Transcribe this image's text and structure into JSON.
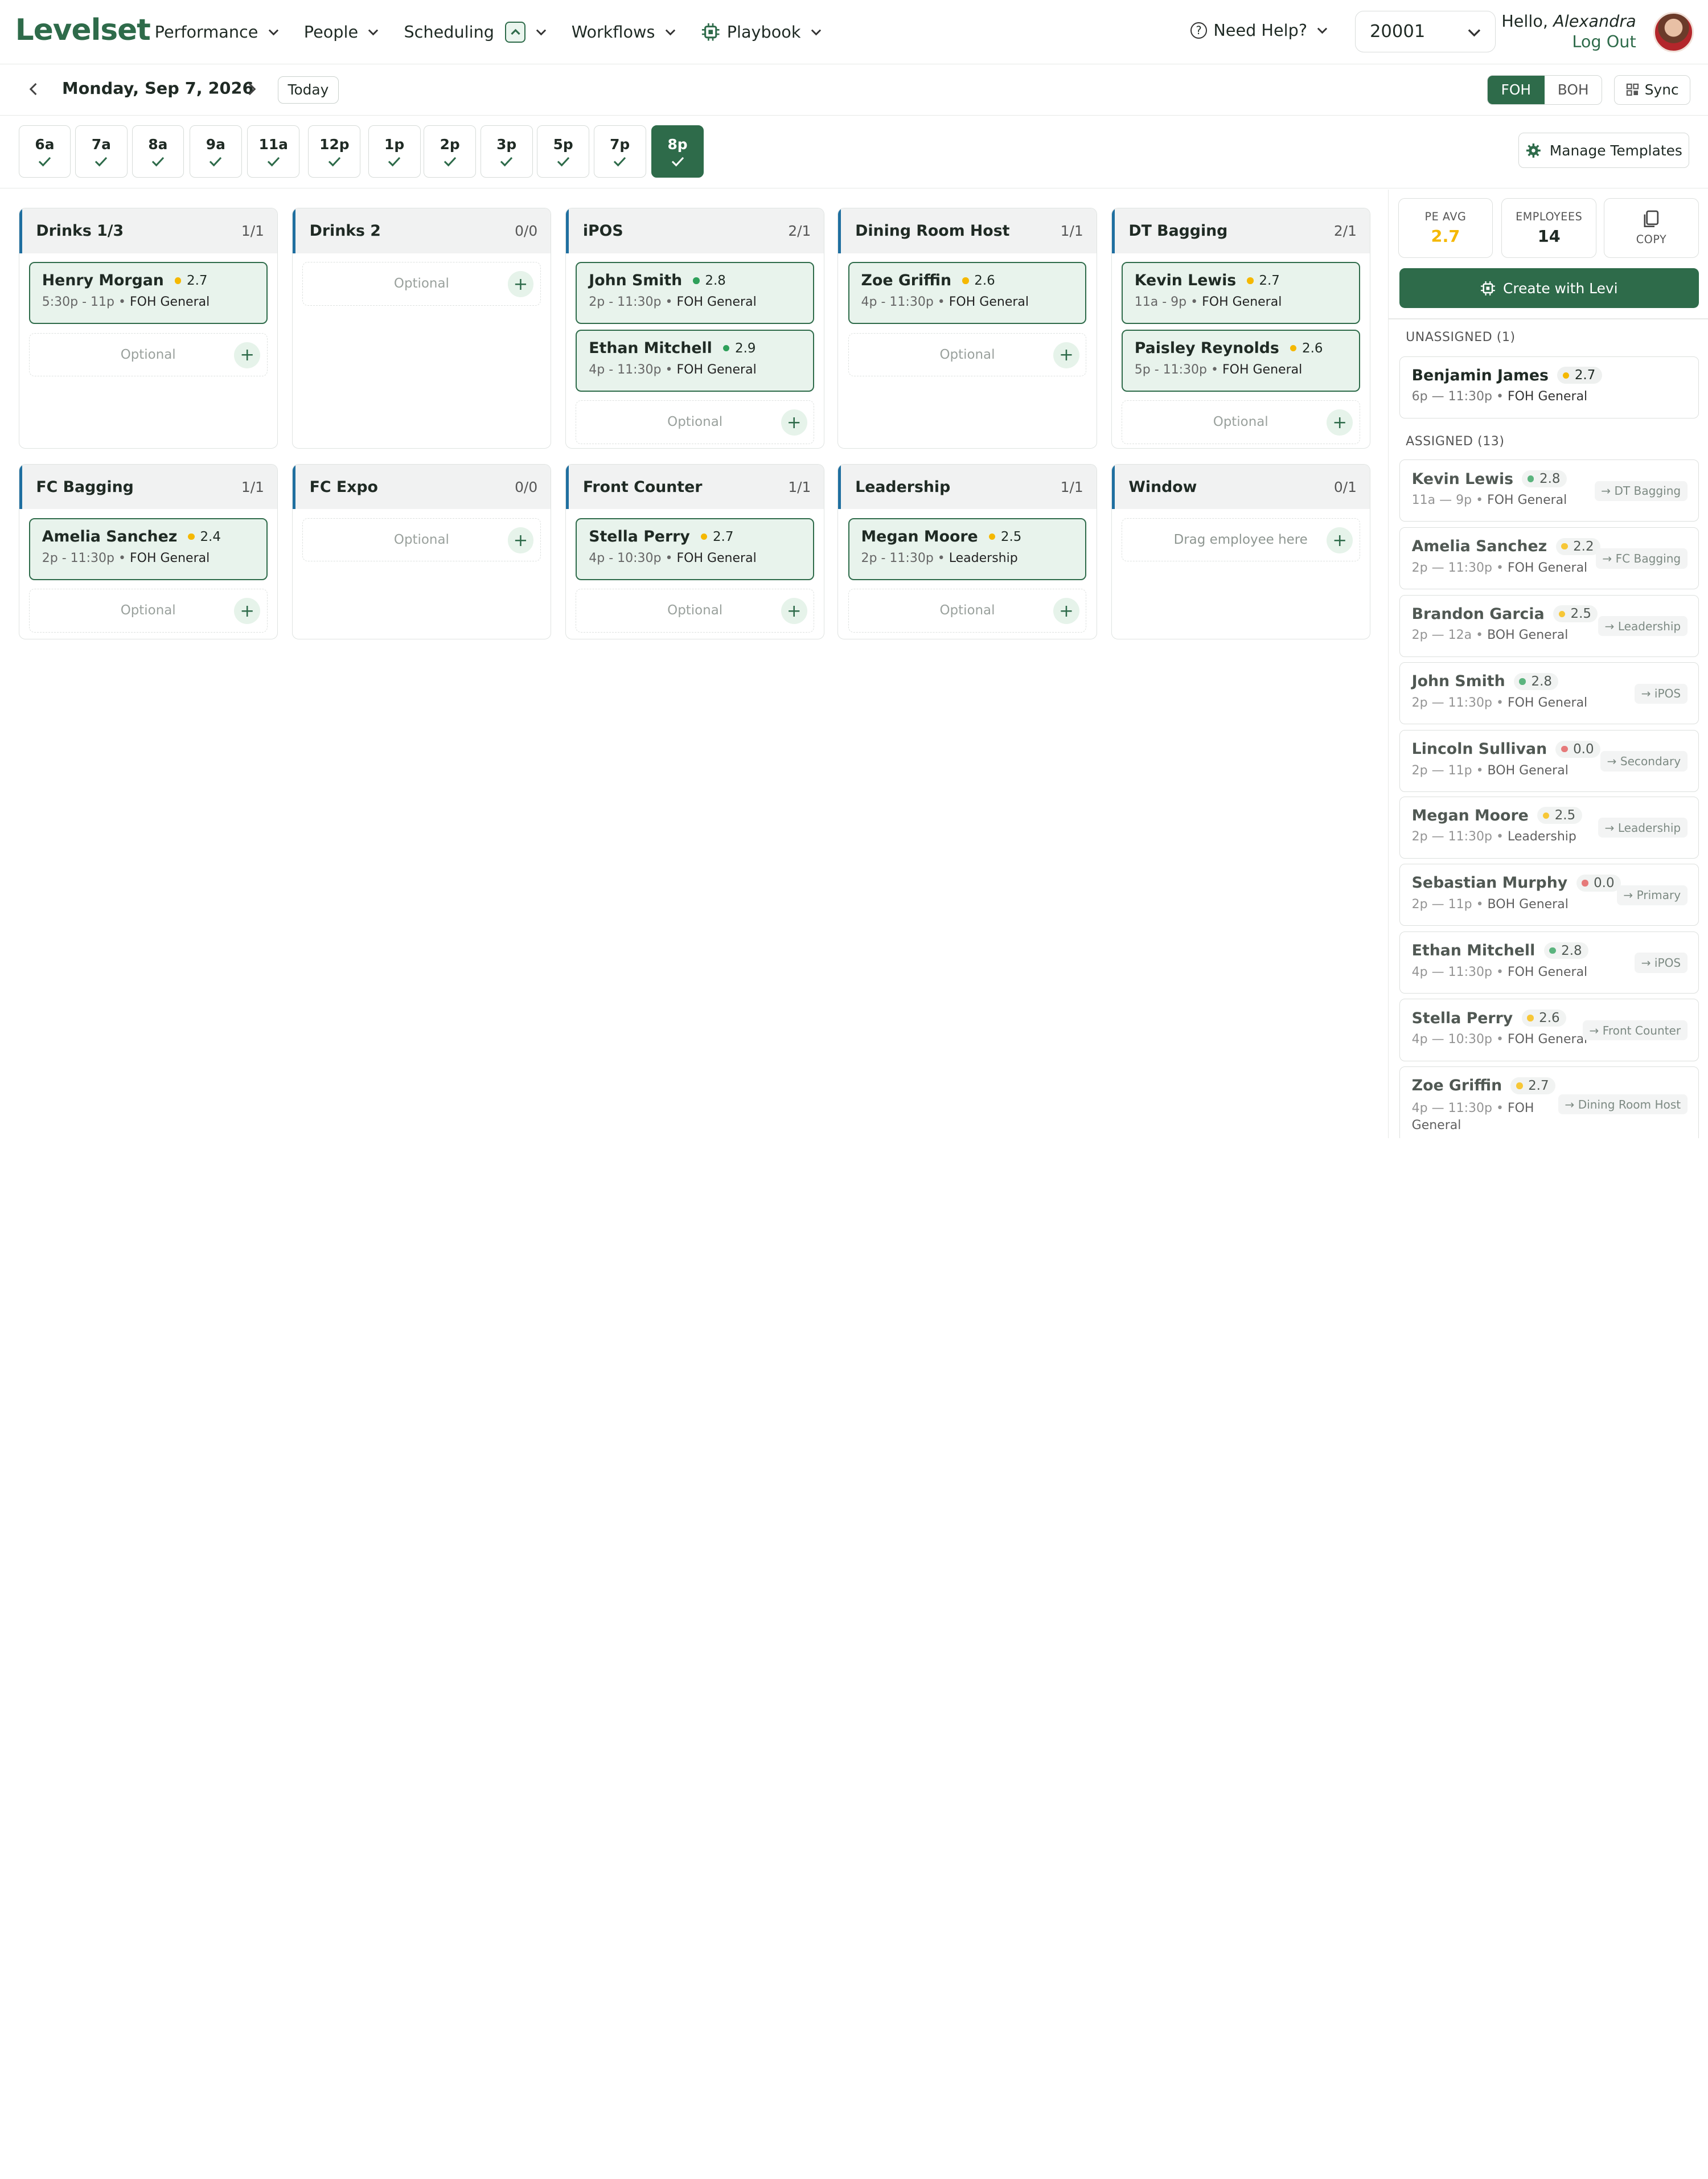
{
  "brand": {
    "logo": "Levelset",
    "accent": "#2e6b4a",
    "station_bar": "#1f6fa0"
  },
  "nav": {
    "items": [
      {
        "label": "Performance",
        "icon": "chevron-down-icon"
      },
      {
        "label": "People",
        "icon": "chevron-down-icon"
      },
      {
        "label": "Scheduling",
        "icon": "chevron-down-icon"
      },
      {
        "label": "Workflows",
        "icon": "chevron-down-icon"
      },
      {
        "label": "Playbook",
        "icon": "chevron-down-icon"
      }
    ],
    "help": "Need Help?",
    "store": "20001",
    "greeting": "Hello,",
    "user_name": "Alexandra",
    "logout": "Log Out"
  },
  "datebar": {
    "date": "Monday, Sep 7, 2026",
    "today": "Today",
    "seg": [
      "FOH",
      "BOH"
    ],
    "seg_selected": "FOH",
    "sync": "Sync"
  },
  "hours": {
    "items": [
      "6a",
      "7a",
      "8a",
      "9a",
      "11a",
      "12p",
      "1p",
      "2p",
      "3p",
      "5p",
      "7p",
      "8p"
    ],
    "selected": "8p",
    "manage": "Manage Templates"
  },
  "stations": [
    {
      "title": "Drinks 1/3",
      "count_a": "1",
      "count_b": "1",
      "assigned": [
        {
          "name": "Henry Morgan",
          "score": "2.7",
          "dot": "#f5b800",
          "time": "5:30p - 11p",
          "role": "FOH General"
        }
      ],
      "optional": "Optional"
    },
    {
      "title": "Drinks 2",
      "count_a": "0",
      "count_b": "0",
      "assigned": [],
      "optional": "Optional"
    },
    {
      "title": "iPOS",
      "count_a": "2",
      "count_b": "1",
      "assigned": [
        {
          "name": "John Smith",
          "score": "2.8",
          "dot": "#2ea05a",
          "time": "2p - 11:30p",
          "role": "FOH General"
        },
        {
          "name": "Ethan Mitchell",
          "score": "2.9",
          "dot": "#2ea05a",
          "time": "4p - 11:30p",
          "role": "FOH General"
        }
      ],
      "optional": "Optional"
    },
    {
      "title": "Dining Room Host",
      "count_a": "1",
      "count_b": "1",
      "assigned": [
        {
          "name": "Zoe Griffin",
          "score": "2.6",
          "dot": "#f5b800",
          "time": "4p - 11:30p",
          "role": "FOH General"
        }
      ],
      "optional": "Optional"
    },
    {
      "title": "DT Bagging",
      "count_a": "2",
      "count_b": "1",
      "assigned": [
        {
          "name": "Kevin Lewis",
          "score": "2.7",
          "dot": "#f5b800",
          "time": "11a - 9p",
          "role": "FOH General"
        },
        {
          "name": "Paisley Reynolds",
          "score": "2.6",
          "dot": "#f5b800",
          "time": "5p - 11:30p",
          "role": "FOH General"
        }
      ],
      "optional": "Optional"
    },
    {
      "title": "FC Bagging",
      "count_a": "1",
      "count_b": "1",
      "assigned": [
        {
          "name": "Amelia Sanchez",
          "score": "2.4",
          "dot": "#f5b800",
          "time": "2p - 11:30p",
          "role": "FOH General"
        }
      ],
      "optional": "Optional"
    },
    {
      "title": "FC Expo",
      "count_a": "0",
      "count_b": "0",
      "assigned": [],
      "optional": "Optional"
    },
    {
      "title": "Front Counter",
      "count_a": "1",
      "count_b": "1",
      "assigned": [
        {
          "name": "Stella Perry",
          "score": "2.7",
          "dot": "#f5b800",
          "time": "4p - 10:30p",
          "role": "FOH General"
        }
      ],
      "optional": "Optional"
    },
    {
      "title": "Leadership",
      "count_a": "1",
      "count_b": "1",
      "assigned": [
        {
          "name": "Megan Moore",
          "score": "2.5",
          "dot": "#f5b800",
          "time": "2p - 11:30p",
          "role": "Leadership"
        }
      ],
      "optional": "Optional"
    },
    {
      "title": "Window",
      "count_a": "0",
      "count_b": "1",
      "assigned": [],
      "optional": "Drag employee here"
    }
  ],
  "panel": {
    "pe_label": "PE AVG",
    "pe_value": "2.7",
    "emp_label": "EMPLOYEES",
    "emp_value": "14",
    "copy_label": "COPY",
    "levi": "Create with Levi",
    "unassigned_label": "UNASSIGNED (1)",
    "unassigned": [
      {
        "name": "Benjamin James",
        "score": "2.7",
        "dot": "#f5b800",
        "time": "6p — 11:30p",
        "role": "FOH General"
      }
    ],
    "assigned_label": "ASSIGNED (13)",
    "assigned": [
      {
        "name": "Kevin Lewis",
        "score": "2.8",
        "dot": "#2ea05a",
        "time": "11a — 9p",
        "role": "FOH General",
        "tag": "DT Bagging"
      },
      {
        "name": "Amelia Sanchez",
        "score": "2.2",
        "dot": "#f5b800",
        "time": "2p — 11:30p",
        "role": "FOH General",
        "tag": "FC Bagging"
      },
      {
        "name": "Brandon Garcia",
        "score": "2.5",
        "dot": "#f5b800",
        "time": "2p — 12a",
        "role": "BOH General",
        "tag": "Leadership"
      },
      {
        "name": "John Smith",
        "score": "2.8",
        "dot": "#2ea05a",
        "time": "2p — 11:30p",
        "role": "FOH General",
        "tag": "iPOS"
      },
      {
        "name": "Lincoln Sullivan",
        "score": "0.0",
        "dot": "#e05555",
        "time": "2p — 11p",
        "role": "BOH General",
        "tag": "Secondary"
      },
      {
        "name": "Megan Moore",
        "score": "2.5",
        "dot": "#f5b800",
        "time": "2p — 11:30p",
        "role": "Leadership",
        "tag": "Leadership"
      },
      {
        "name": "Sebastian Murphy",
        "score": "0.0",
        "dot": "#e05555",
        "time": "2p — 11p",
        "role": "BOH General",
        "tag": "Primary"
      },
      {
        "name": "Ethan Mitchell",
        "score": "2.8",
        "dot": "#2ea05a",
        "time": "4p — 11:30p",
        "role": "FOH General",
        "tag": "iPOS"
      },
      {
        "name": "Stella Perry",
        "score": "2.6",
        "dot": "#f5b800",
        "time": "4p — 10:30p",
        "role": "FOH General",
        "tag": "Front Counter"
      },
      {
        "name": "Zoe Griffin",
        "score": "2.7",
        "dot": "#f5b800",
        "time": "4p — 11:30p",
        "role": "FOH General",
        "tag": "Dining Room Host"
      }
    ]
  }
}
